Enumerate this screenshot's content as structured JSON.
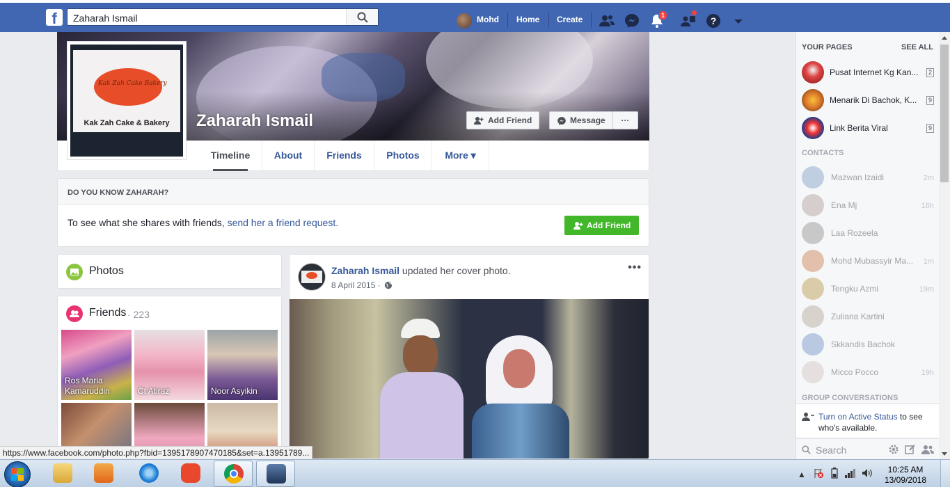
{
  "topbar": {
    "search_value": "Zaharah Ismail",
    "user_name": "Mohd",
    "home_label": "Home",
    "create_label": "Create",
    "notifications_badge": "1"
  },
  "profile": {
    "name": "Zaharah Ismail",
    "add_friend_label": "Add Friend",
    "message_label": "Message",
    "more_dots": "···",
    "picture_caption": "Kak Zah Cake & Bakery",
    "picture_logo_text": "Kak Zah Cake Bakery"
  },
  "tabs": [
    {
      "label": "Timeline"
    },
    {
      "label": "About"
    },
    {
      "label": "Friends"
    },
    {
      "label": "Photos"
    },
    {
      "label": "More ▾"
    }
  ],
  "know": {
    "title": "DO YOU KNOW ZAHARAH?",
    "text": "To see what she shares with friends, ",
    "link": "send her a friend request.",
    "button": "Add Friend"
  },
  "photos_card": {
    "title": "Photos"
  },
  "friends_card": {
    "title": "Friends",
    "count": "· 223",
    "friends": [
      {
        "name": "Ros Maria Kamaruddin"
      },
      {
        "name": "Ct Atiraz"
      },
      {
        "name": "Noor Asyikin"
      }
    ]
  },
  "post": {
    "author": "Zaharah Ismail",
    "action": " updated her cover photo.",
    "date": "8 April 2015 ·",
    "menu": "•••"
  },
  "sidebar": {
    "pages_title": "YOUR PAGES",
    "see_all": "SEE ALL",
    "pages": [
      {
        "name": "Pusat Internet Kg Kan...",
        "count": "2"
      },
      {
        "name": "Menarik Di Bachok, K...",
        "count": "9"
      },
      {
        "name": "Link Berita Viral",
        "count": "9"
      }
    ],
    "contacts_title": "CONTACTS",
    "contacts": [
      {
        "name": "Mazwan Izaidi",
        "time": "2m"
      },
      {
        "name": "Ena Mj",
        "time": "16h"
      },
      {
        "name": "Laa Rozeela",
        "time": ""
      },
      {
        "name": "Mohd Mubassyir Ma...",
        "time": "1m"
      },
      {
        "name": "Tengku Azmi",
        "time": "19m"
      },
      {
        "name": "Zuliana Kartini",
        "time": ""
      },
      {
        "name": "Skkandis Bachok",
        "time": ""
      },
      {
        "name": "Micco Pocco",
        "time": "19h"
      }
    ],
    "group_title": "GROUP CONVERSATIONS",
    "active_link": "Turn on Active Status",
    "active_rest": " to see who's available.",
    "search_placeholder": "Search"
  },
  "status_url": "https://www.facebook.com/photo.php?fbid=1395178907470185&set=a.13951789...",
  "taskbar": {
    "time": "10:25 AM",
    "date": "13/09/2018"
  },
  "colors": {
    "brand_blue": "#4267b2",
    "link_blue": "#365899",
    "green": "#42b72a",
    "badge_red": "#fa3e3e"
  }
}
